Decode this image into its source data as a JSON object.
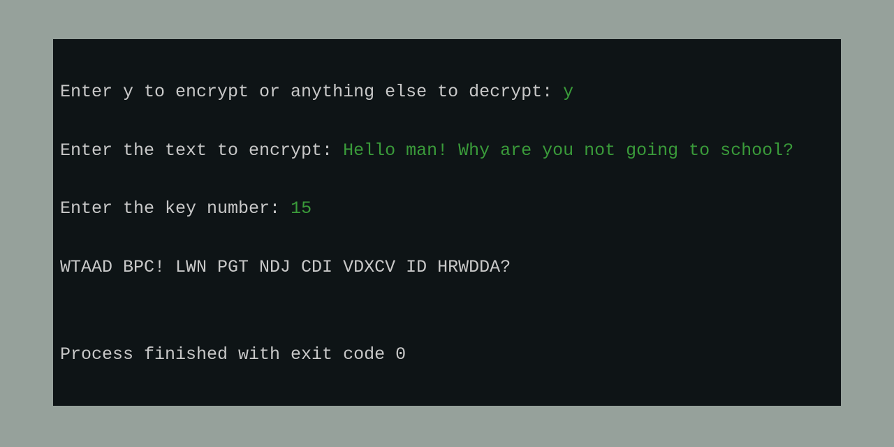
{
  "console": {
    "line1": {
      "prompt": "Enter y to encrypt or anything else to decrypt: ",
      "input": "y"
    },
    "line2": {
      "prompt": "Enter the text to encrypt: ",
      "input": "Hello man! Why are you not going to school?"
    },
    "line3": {
      "prompt": "Enter the key number: ",
      "input": "15"
    },
    "line4": "WTAAD BPC! LWN PGT NDJ CDI VDXCV ID HRWDDA?",
    "line5": "",
    "line6": "Process finished with exit code 0"
  }
}
